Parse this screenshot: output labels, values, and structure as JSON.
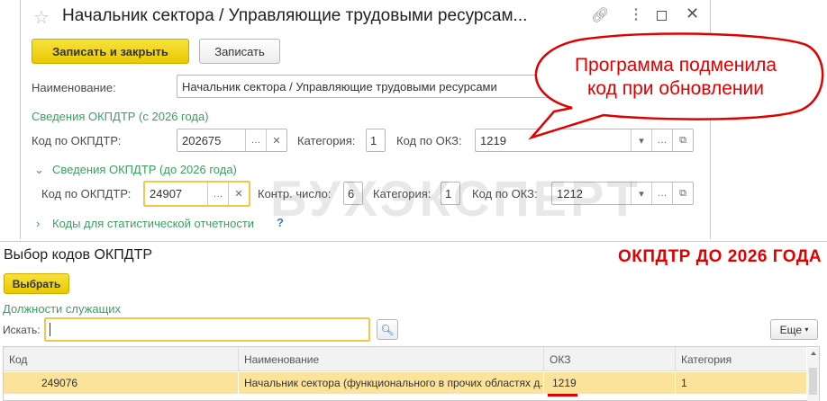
{
  "window": {
    "title": "Начальник сектора / Управляющие трудовыми ресурсам...",
    "save_close": "Записать и закрыть",
    "save": "Записать"
  },
  "form": {
    "name_label": "Наименование:",
    "name_value": "Начальник сектора / Управляющие трудовыми ресурсами",
    "new_section": "Сведения ОКПДТР (с 2026 года)",
    "new_code_label": "Код по ОКПДТР:",
    "new_code": "202675",
    "new_cat_label": "Категория:",
    "new_cat": "1",
    "new_okz_label": "Код по ОКЗ:",
    "new_okz": "1219",
    "old_section": "Сведения ОКПДТР (до 2026 года)",
    "old_code_label": "Код по ОКПДТР:",
    "old_code": "24907",
    "ctrl_label": "Контр. число:",
    "ctrl": "6",
    "old_cat_label": "Категория:",
    "old_cat": "1",
    "old_okz_label": "Код по ОКЗ:",
    "old_okz": "1212",
    "stat_section": "Коды для статистической отчетности",
    "help": "?"
  },
  "callout": {
    "line1": "Программа подменила",
    "line2": "код при обновлении"
  },
  "watermark": "БУХЭКСПЕРТ",
  "panel": {
    "title": "Выбор кодов ОКПДТР",
    "annotation": "ОКПДТР ДО 2026 ГОДА",
    "select": "Выбрать",
    "group": "Должности служащих",
    "search_label": "Искать:",
    "search_value": "",
    "more": "Еще",
    "columns": [
      "Код",
      "Наименование",
      "ОКЗ",
      "Категория"
    ],
    "rows": [
      [
        "249076",
        "Начальник сектора (функционального в прочих областях д...",
        "1219",
        "1"
      ]
    ]
  },
  "colors": {
    "accent": "#f0d000",
    "green": "#3aa060",
    "red": "#e00000"
  }
}
